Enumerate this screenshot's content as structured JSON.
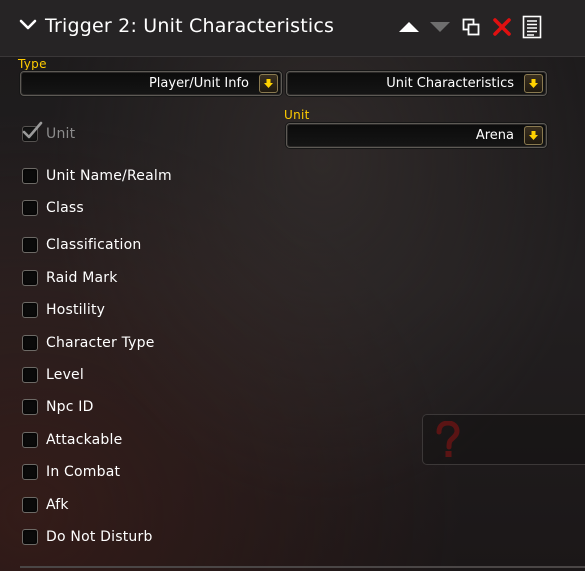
{
  "header": {
    "title": "Trigger 2: Unit Characteristics"
  },
  "type": {
    "label": "Type",
    "primary_value": "Player/Unit Info",
    "secondary_value": "Unit Characteristics"
  },
  "unit": {
    "checkbox_label": "Unit",
    "dropdown_label": "Unit",
    "value": "Arena"
  },
  "options": [
    {
      "label": "Unit Name/Realm"
    },
    {
      "label": "Class"
    },
    {
      "label": "Classification"
    },
    {
      "label": "Raid Mark"
    },
    {
      "label": "Hostility"
    },
    {
      "label": "Character Type"
    },
    {
      "label": "Level"
    },
    {
      "label": "Npc ID"
    },
    {
      "label": "Attackable"
    },
    {
      "label": "In Combat"
    },
    {
      "label": "Afk"
    },
    {
      "label": "Do Not Disturb"
    }
  ],
  "colors": {
    "accent_label": "#ffcc00",
    "delete": "#e01010"
  },
  "icons": [
    "chevron-down-icon",
    "move-up-icon",
    "move-down-icon",
    "duplicate-icon",
    "delete-icon",
    "notes-icon",
    "arrow-down-icon",
    "question-mark-icon"
  ]
}
